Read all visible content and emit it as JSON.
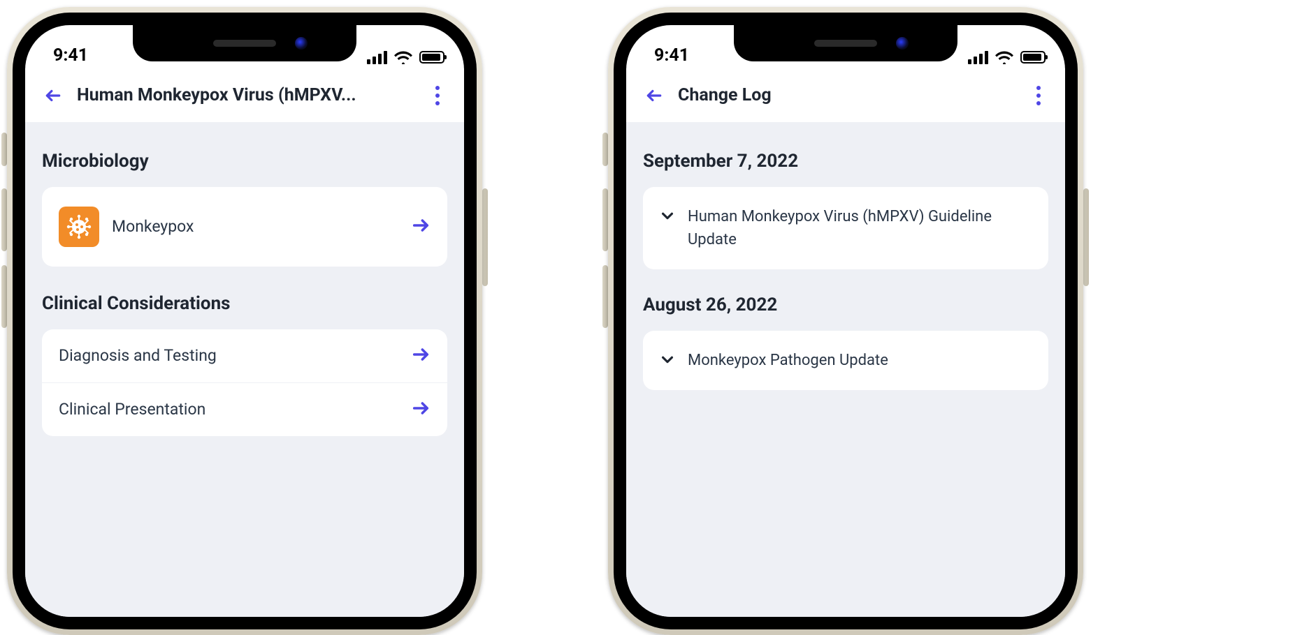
{
  "status": {
    "time": "9:41"
  },
  "screen_left": {
    "header_title": "Human Monkeypox Virus (hMPXV...",
    "sections": {
      "microbiology": {
        "title": "Microbiology",
        "item": "Monkeypox"
      },
      "clinical": {
        "title": "Clinical Considerations",
        "items": {
          "diagnosis": "Diagnosis and Testing",
          "presentation": "Clinical Presentation"
        }
      }
    }
  },
  "screen_right": {
    "header_title": "Change Log",
    "groups": {
      "g1": {
        "date": "September 7, 2022",
        "entry": "Human Monkeypox Virus (hMPXV) Guideline Update"
      },
      "g2": {
        "date": "August 26, 2022",
        "entry": "Monkeypox Pathogen Update"
      }
    }
  }
}
